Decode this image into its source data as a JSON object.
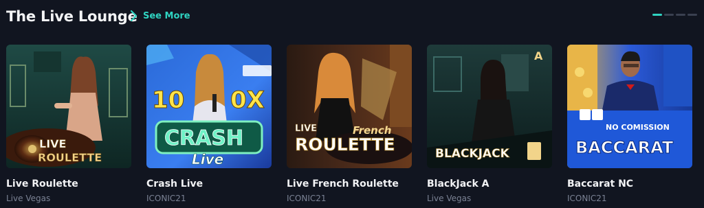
{
  "section": {
    "title": "The Live Lounge",
    "see_more": "See More"
  },
  "pager": {
    "active_index": 0,
    "count": 4
  },
  "games": [
    {
      "name": "Live Roulette",
      "provider": "Live Vegas",
      "art_lines": [
        "LIVE",
        "ROULETTE"
      ]
    },
    {
      "name": "Crash Live",
      "provider": "ICONIC21",
      "art_lines": [
        "10",
        "0X",
        "CRASH",
        "Live"
      ]
    },
    {
      "name": "Live French Roulette",
      "provider": "ICONIC21",
      "art_lines": [
        "LIVE",
        "French",
        "ROULETTE"
      ]
    },
    {
      "name": "BlackJack A",
      "provider": "Live Vegas",
      "art_lines": [
        "A",
        "BLACKJACK"
      ]
    },
    {
      "name": "Baccarat NC",
      "provider": "ICONIC21",
      "art_lines": [
        "NO COMISSION",
        "BACCARAT"
      ]
    }
  ],
  "colors": {
    "background": "#111520",
    "accent": "#2fd3c1",
    "muted": "#7b8294"
  }
}
